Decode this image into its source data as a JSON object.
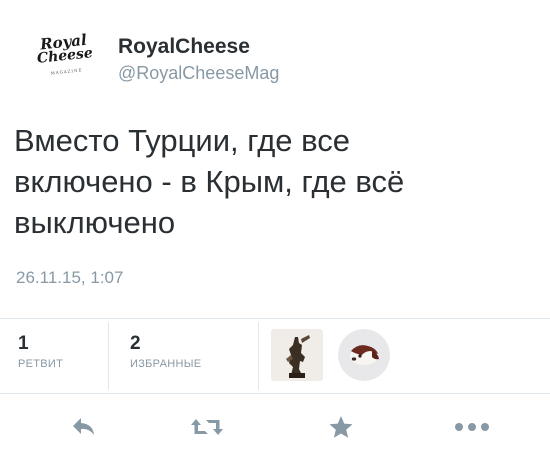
{
  "author": {
    "logo_line1": "Royal",
    "logo_line2": "Cheese",
    "logo_tiny": "MAGAZINE",
    "display_name": "RoyalCheese",
    "handle": "@RoyalCheeseMag"
  },
  "tweet": {
    "text": "Вместо Турции, где все\nвключено - в Крым, где всё\nвыключено",
    "timestamp": "26.11.15, 1:07"
  },
  "stats": {
    "retweets_count": "1",
    "retweets_label": "РЕТВИТ",
    "favorites_count": "2",
    "favorites_label": "ИЗБРАННЫЕ"
  },
  "favorited_by_avatars": [
    "statue-avatar",
    "dog-avatar"
  ],
  "actions": {
    "icons": [
      "reply-icon",
      "retweet-icon",
      "favorite-icon",
      "more-icon"
    ]
  },
  "colors": {
    "text": "#292f33",
    "muted": "#8899a6",
    "divider": "#e1e8ed"
  }
}
